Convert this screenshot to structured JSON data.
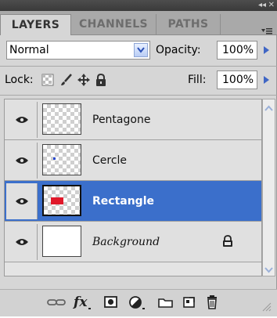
{
  "panel": {
    "collapse_glyph": "◂◂",
    "close_glyph": "✕"
  },
  "tabs": [
    {
      "label": "LAYERS",
      "active": true
    },
    {
      "label": "CHANNELS",
      "active": false
    },
    {
      "label": "PATHS",
      "active": false
    }
  ],
  "blend_mode": {
    "value": "Normal"
  },
  "opacity": {
    "label": "Opacity:",
    "value": "100%"
  },
  "lock": {
    "label": "Lock:"
  },
  "fill": {
    "label": "Fill:",
    "value": "100%"
  },
  "layers": [
    {
      "name": "Pentagone",
      "visible": true,
      "selected": false,
      "thumb": "transparent"
    },
    {
      "name": "Cercle",
      "visible": true,
      "selected": false,
      "thumb": "transparent-dot"
    },
    {
      "name": "Rectangle",
      "visible": true,
      "selected": true,
      "thumb": "red-rect",
      "thumb_color": "#e0182a"
    },
    {
      "name": "Background",
      "visible": true,
      "selected": false,
      "thumb": "white",
      "locked": true
    }
  ],
  "colors": {
    "selection": "#3b6fcb",
    "accent_arrow": "#3f66c5"
  },
  "toolbar_icons": [
    "link-layers-icon",
    "fx-icon",
    "add-mask-icon",
    "adjustment-layer-icon",
    "new-group-icon",
    "new-layer-icon",
    "delete-layer-icon"
  ]
}
